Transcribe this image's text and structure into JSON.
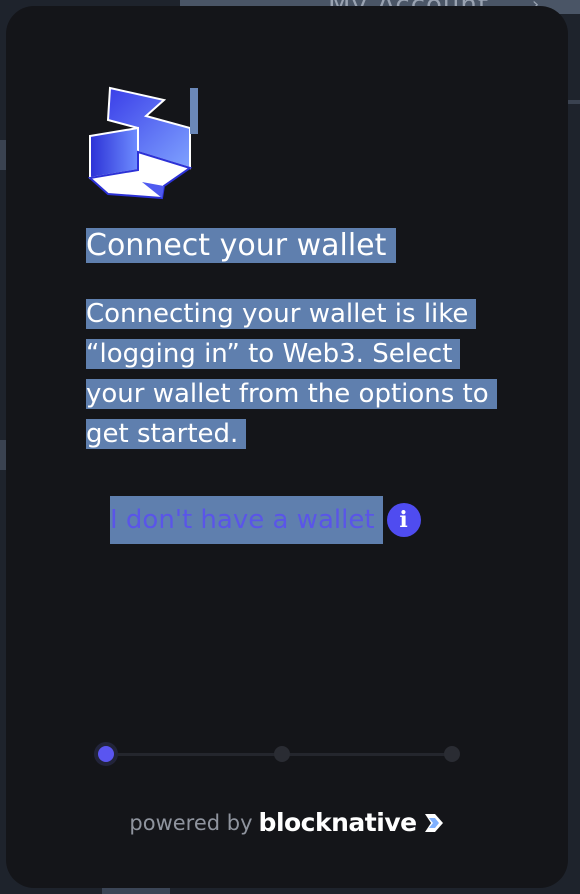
{
  "background": {
    "account_label": "My Account",
    "chevron": "›"
  },
  "modal": {
    "title": "Connect your wallet",
    "description": "Connecting your wallet is like “logging in” to Web3. Select your wallet from the options to get started.",
    "no_wallet_label": "I don't have a wallet",
    "info_icon_glyph": "i",
    "steps": [
      {
        "active": true
      },
      {
        "active": false
      },
      {
        "active": false
      }
    ],
    "footer": {
      "powered_by": "powered by",
      "brand": "blocknative"
    }
  },
  "colors": {
    "modal_bg": "#141519",
    "accent": "#5a55f0",
    "selection": "#5f7fae",
    "text": "#ffffff",
    "muted": "#8f949e"
  },
  "icons": {
    "logo": "wallet-app-logo-icon",
    "info": "info-icon",
    "brand": "blocknative-logo-icon"
  }
}
